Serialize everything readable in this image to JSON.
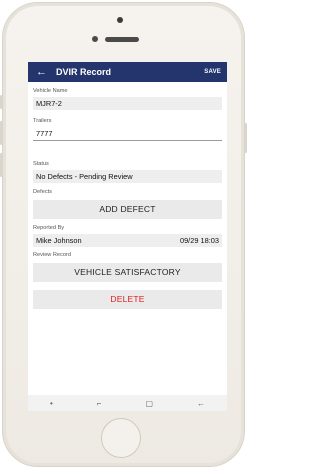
{
  "appbar": {
    "back_icon": "←",
    "title": "DVIR Record",
    "save_label": "SAVE"
  },
  "fields": {
    "vehicle_name": {
      "label": "Vehicle Name",
      "value": "MJR7-2"
    },
    "trailers": {
      "label": "Trailers",
      "value": "7777"
    },
    "status": {
      "label": "Status",
      "value": "No Defects - Pending Review"
    },
    "defects": {
      "label": "Defects",
      "button": "ADD DEFECT"
    },
    "reported_by": {
      "label": "Reported By",
      "name": "Mike Johnson",
      "date": "09/29 18:03"
    },
    "review_record": {
      "label": "Review Record",
      "button": "VEHICLE SATISFACTORY"
    },
    "delete_button": "DELETE"
  },
  "navbar": {
    "dot": "•",
    "recents": "⌐",
    "home": "▢",
    "back": "←"
  },
  "colors": {
    "appbar": "#24356d",
    "delete": "#e21d1d"
  }
}
